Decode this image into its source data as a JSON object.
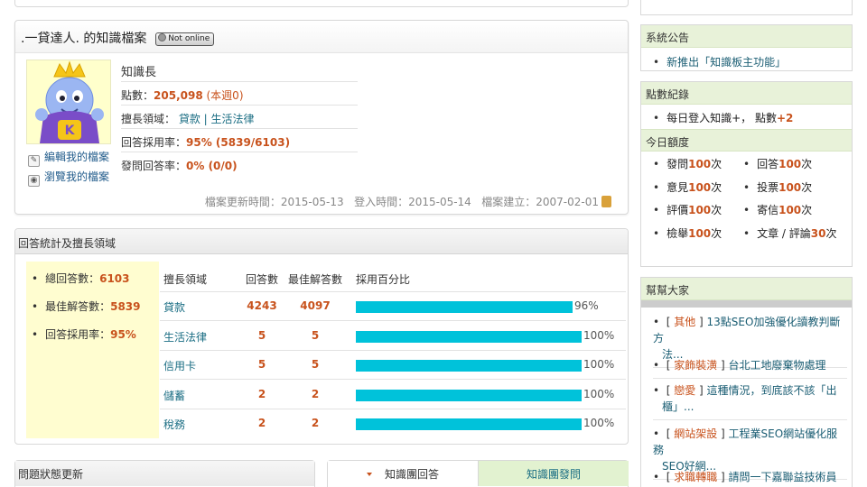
{
  "profile": {
    "title": ".一貸達人. 的知識檔案",
    "status": "Not online",
    "rank": "知識長",
    "points_label": "點數：",
    "points_value": "205,098",
    "points_week": "(本週0)",
    "expertise_label": "擅長領域：",
    "expertise_value": "貸款 | 生活法律",
    "answer_rate_label": "回答採用率：",
    "answer_rate_value": "95% (5839/6103)",
    "question_rate_label": "發問回答率：",
    "question_rate_value": "0% (0/0)",
    "edit_link": "編輯我的檔案",
    "view_link": "瀏覽我的檔案",
    "meta": "檔案更新時間：2015-05-13   登入時間：2015-05-14   檔案建立：2007-02-01"
  },
  "stats": {
    "header": "回答統計及擅長領域",
    "summary": [
      {
        "label": "總回答數：",
        "value": "6103"
      },
      {
        "label": "最佳解答數：",
        "value": "5839"
      },
      {
        "label": "回答採用率：",
        "value": "95%"
      }
    ],
    "columns": [
      "擅長領域",
      "回答數",
      "最佳解答數",
      "採用百分比"
    ],
    "rows": [
      {
        "field": "貸款",
        "answers": "4243",
        "best": "4097",
        "pct": "96%",
        "fraction": 0.96
      },
      {
        "field": "生活法律",
        "answers": "5",
        "best": "5",
        "pct": "100%",
        "fraction": 1.0
      },
      {
        "field": "信用卡",
        "answers": "5",
        "best": "5",
        "pct": "100%",
        "fraction": 1.0
      },
      {
        "field": "儲蓄",
        "answers": "2",
        "best": "2",
        "pct": "100%",
        "fraction": 1.0
      },
      {
        "field": "稅務",
        "answers": "2",
        "best": "2",
        "pct": "100%",
        "fraction": 1.0
      }
    ]
  },
  "bottom": {
    "status_header": "問題狀態更新",
    "tab_active": "知識團回答",
    "tab_other": "知識團發問"
  },
  "sidebar": {
    "announce_header": "系統公告",
    "announce_item": "新推出「知識板主功能」",
    "points_header": "點數紀錄",
    "points_item_text": "每日登入知識+， 點數",
    "points_item_value": "+2",
    "quota_header": "今日額度",
    "quota": [
      {
        "label": "發問",
        "value": "100",
        "unit": "次"
      },
      {
        "label": "回答",
        "value": "100",
        "unit": "次"
      },
      {
        "label": "意見",
        "value": "100",
        "unit": "次"
      },
      {
        "label": "投票",
        "value": "100",
        "unit": "次"
      },
      {
        "label": "評價",
        "value": "100",
        "unit": "次"
      },
      {
        "label": "寄信",
        "value": "100",
        "unit": "次"
      },
      {
        "label": "檢舉",
        "value": "100",
        "unit": "次"
      },
      {
        "label": "文章 / 評論",
        "value": "30",
        "unit": "次"
      }
    ],
    "help_header": "幫幫大家",
    "help": [
      {
        "cat": "其他",
        "line1": "13點SEO加強優化讀教判斷方",
        "line2": "法..."
      },
      {
        "cat": "家飾裝潢",
        "line1": "台北工地廢棄物處理",
        "line2": ""
      },
      {
        "cat": "戀愛",
        "line1": "這種情況，到底該不該「出",
        "line2": "櫃」..."
      },
      {
        "cat": "網站架設",
        "line1": "工程業SEO網站優化服務",
        "line2": "SEO好網..."
      },
      {
        "cat": "求職轉職",
        "line1": "請問一下嘉聯益技術員薪",
        "line2": ""
      }
    ]
  }
}
